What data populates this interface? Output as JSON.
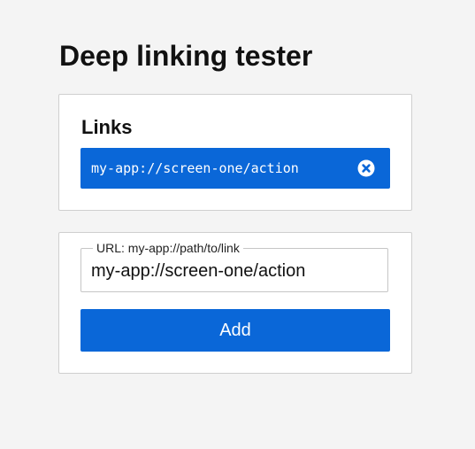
{
  "page": {
    "title": "Deep linking tester"
  },
  "links_section": {
    "title": "Links",
    "items": [
      {
        "url": "my-app://screen-one/action",
        "remove_icon": "close-circle-icon"
      }
    ]
  },
  "form": {
    "url_label": "URL: my-app://path/to/link",
    "url_value": "my-app://screen-one/action",
    "add_label": "Add"
  },
  "colors": {
    "background": "#f4f4f4",
    "accent": "#0a67d8",
    "card": "#ffffff",
    "border": "#cfcfcf"
  }
}
